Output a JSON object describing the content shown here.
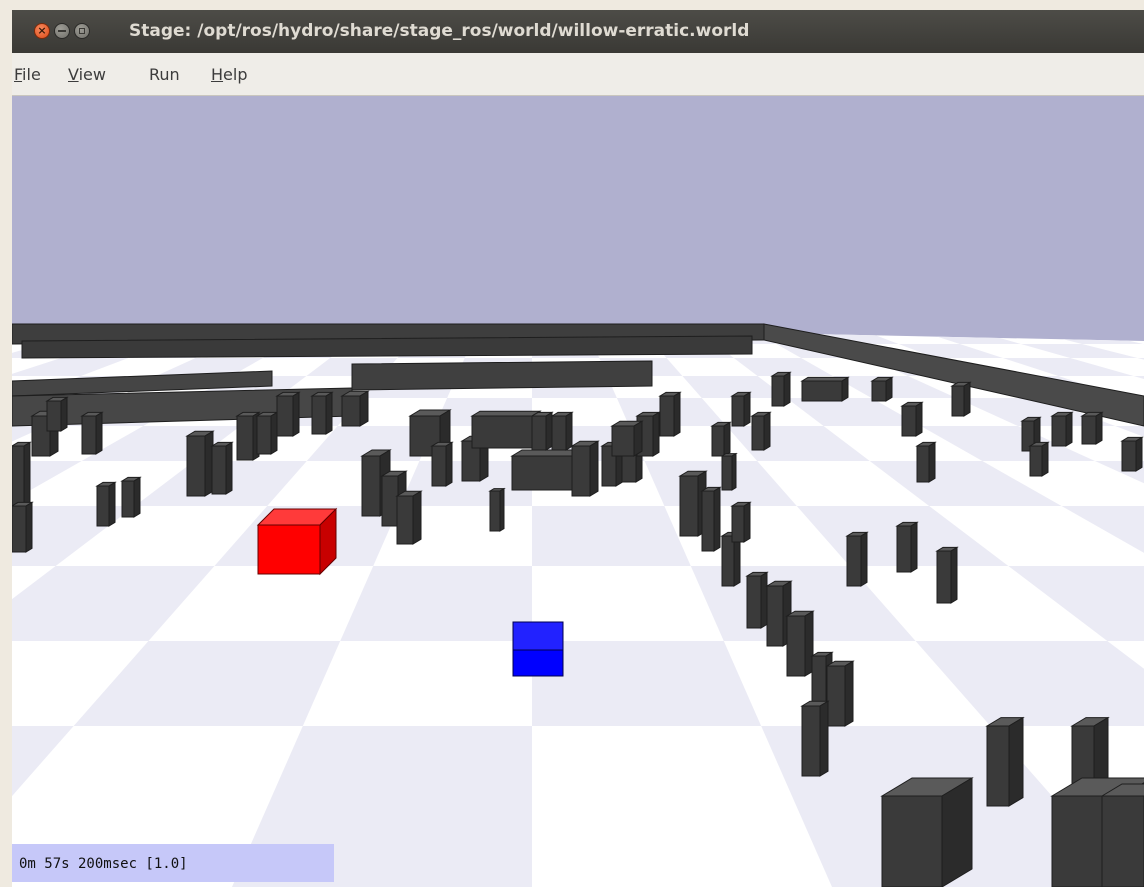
{
  "window": {
    "title": "Stage: /opt/ros/hydro/share/stage_ros/world/willow-erratic.world",
    "controls": [
      "close-icon",
      "minimize-icon",
      "maximize-icon"
    ]
  },
  "menu": {
    "file": "File",
    "view": "View",
    "run": "Run",
    "help": "Help"
  },
  "viewport": {
    "sky_color": "#b0b0cf",
    "floor_colors": [
      "#ffffff",
      "#ebebf5"
    ],
    "obstacle_color": "#3a3a3a",
    "robots": [
      {
        "name": "red-robot",
        "color": "#ff0000"
      },
      {
        "name": "blue-robot",
        "color": "#0000ff"
      }
    ]
  },
  "status": {
    "text": "0m 57s 200msec [1.0]"
  }
}
